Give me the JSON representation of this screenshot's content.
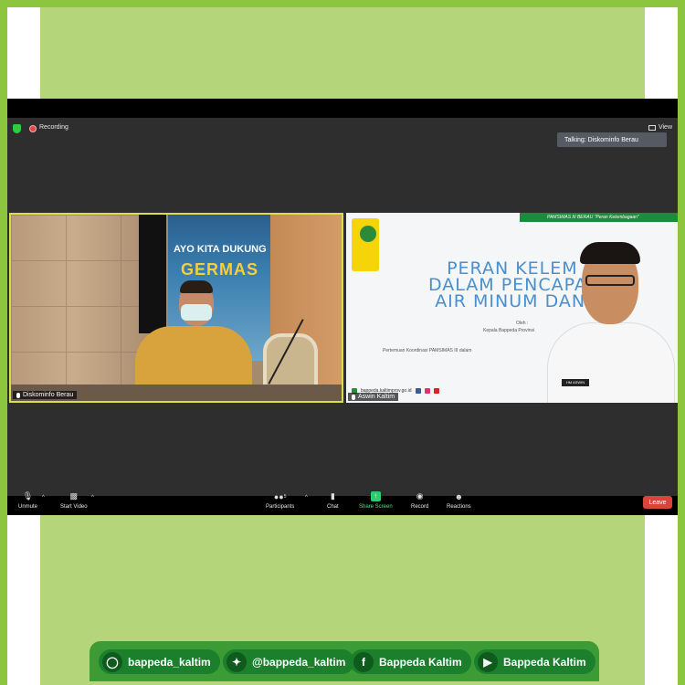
{
  "topbar": {
    "recording_label": "Recording",
    "view_label": "View",
    "talking_label": "Talking: Diskominfo Berau"
  },
  "tiles": {
    "left_name": "Diskominfo Berau",
    "left_banner_line1": "AYO KITA DUKUNG",
    "left_banner_line2": "GERMAS",
    "right_name": "Aswin Kaltim",
    "slide_strip": "PAMSIMAS III BERAU \"Peran Kelembagaan\"",
    "slide_title_1": "PERAN KELEM    AN",
    "slide_title_2": "DALAM PENCAPA      SES",
    "slide_title_3": "AIR MINUM DAN    ASI",
    "slide_oleh": "Oleh :",
    "slide_kepala": "Kepala Bappeda Provinsi",
    "slide_pertemuan": "Pertemuan Koordinasi PAMSIMAS III dalam",
    "slide_website": "bappeda.kaltimprov.go.id",
    "nametag": "HM ASWIN"
  },
  "toolbar": {
    "unmute": "Unmute",
    "start_video": "Start Video",
    "participants": "Participants",
    "participants_count": "5",
    "chat": "Chat",
    "share_screen": "Share Screen",
    "record": "Record",
    "reactions": "Reactions",
    "leave": "Leave"
  },
  "social": {
    "instagram": "bappeda_kaltim",
    "twitter": "@bappeda_kaltim",
    "facebook": "Bappeda Kaltim",
    "youtube": "Bappeda Kaltim"
  },
  "colors": {
    "brand_green": "#8cc63f",
    "panel_green": "#b5d57b",
    "social_green": "#1b7f2c",
    "leave_red": "#d9453d",
    "share_green": "#2ecc71"
  }
}
